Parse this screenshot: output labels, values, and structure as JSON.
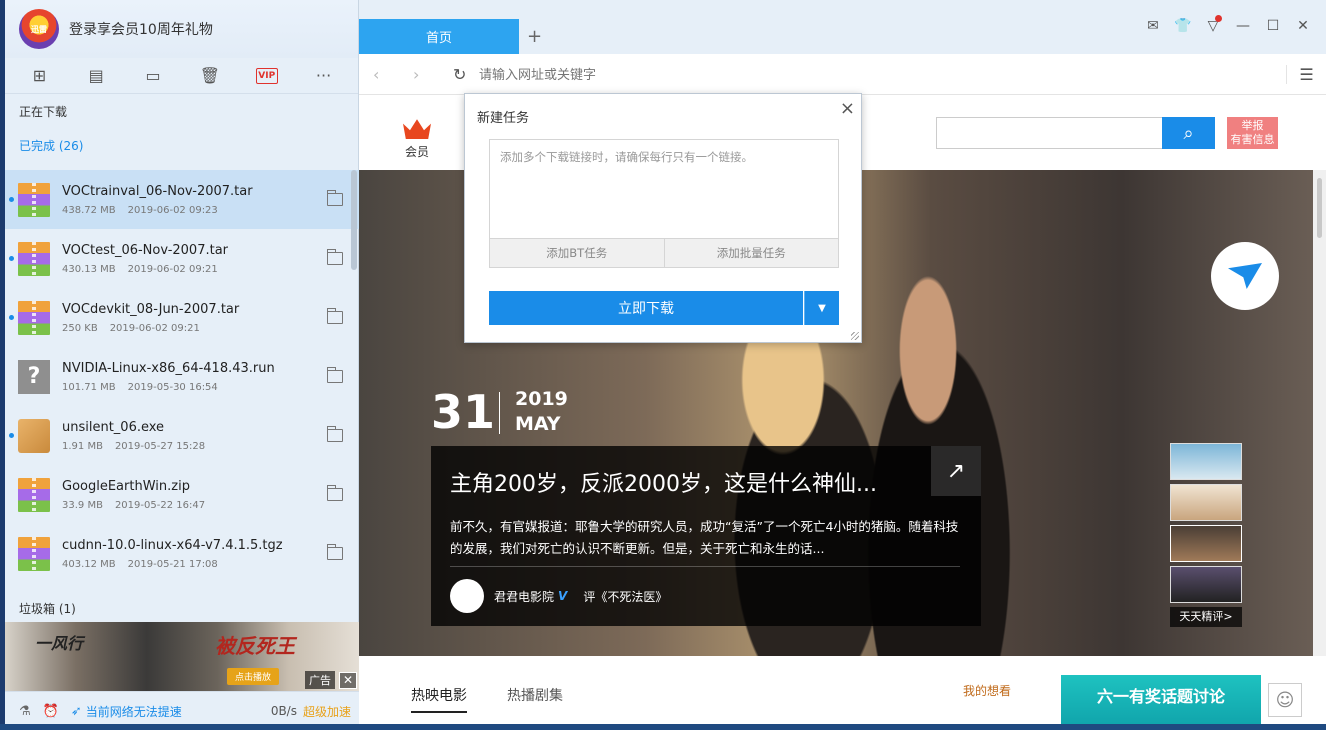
{
  "left": {
    "login_text": "登录享会员10周年礼物",
    "avatar_text": "迅雷",
    "toolbar": [
      {
        "name": "new-task-icon",
        "glyph": "⊞"
      },
      {
        "name": "file-icon",
        "glyph": "▤"
      },
      {
        "name": "folder-icon",
        "glyph": "▭"
      },
      {
        "name": "trash-icon",
        "glyph": "🗑"
      },
      {
        "name": "vip-icon",
        "glyph": "VIP"
      },
      {
        "name": "more-icon",
        "glyph": "···"
      }
    ],
    "downloading_label": "正在下载",
    "completed_label": "已完成 (26)",
    "items": [
      {
        "name": "VOCtrainval_06-Nov-2007.tar",
        "size": "438.72 MB",
        "date": "2019-06-02 09:23",
        "type": "zip"
      },
      {
        "name": "VOCtest_06-Nov-2007.tar",
        "size": "430.13 MB",
        "date": "2019-06-02 09:21",
        "type": "zip"
      },
      {
        "name": "VOCdevkit_08-Jun-2007.tar",
        "size": "250 KB",
        "date": "2019-06-02 09:21",
        "type": "zip"
      },
      {
        "name": "NVIDIA-Linux-x86_64-418.43.run",
        "size": "101.71 MB",
        "date": "2019-05-30 16:54",
        "type": "unknown"
      },
      {
        "name": "unsilent_06.exe",
        "size": "1.91 MB",
        "date": "2019-05-27 15:28",
        "type": "box"
      },
      {
        "name": "GoogleEarthWin.zip",
        "size": "33.9 MB",
        "date": "2019-05-22 16:47",
        "type": "zip"
      },
      {
        "name": "cudnn-10.0-linux-x64-v7.4.1.5.tgz",
        "size": "403.12 MB",
        "date": "2019-05-21 17:08",
        "type": "zip"
      }
    ],
    "trash_label": "垃圾箱 (1)",
    "ad": {
      "title_left": "一风行",
      "title_right": "被反死王",
      "button": "点击播放",
      "label": "广告",
      "close": "✕"
    },
    "status": {
      "network_text": "当前网络无法提速",
      "speed": "0B/s",
      "boost": "超级加速"
    }
  },
  "browser": {
    "tab_label": "首页",
    "tab_add": "+",
    "address_placeholder": "请输入网址或关键字",
    "page": {
      "member_label": "会员",
      "report_line1": "举报",
      "report_line2": "有害信息",
      "hero": {
        "day": "31",
        "year": "2019",
        "month": "MAY",
        "title": "主角200岁，反派2000岁，这是什么神仙...",
        "desc": "前不久，有官媒报道：耶鲁大学的研究人员，成功“复活”了一个死亡4小时的猪脑。随着科技的发展，我们对死亡的认识不断更新。但是，关于死亡和永生的话...",
        "author": "君君电影院",
        "verified": "V",
        "review": "评《不死法医》",
        "daily_review": "天天精评>"
      },
      "tabs": [
        "热映电影",
        "热播剧集"
      ],
      "want_label": "我的想看",
      "promo_text": "六一有奖话题讨论"
    }
  },
  "dialog": {
    "title": "新建任务",
    "close": "×",
    "placeholder": "添加多个下载链接时，请确保每行只有一个链接。",
    "add_bt": "添加BT任务",
    "add_batch": "添加批量任务",
    "download_now": "立即下载"
  }
}
